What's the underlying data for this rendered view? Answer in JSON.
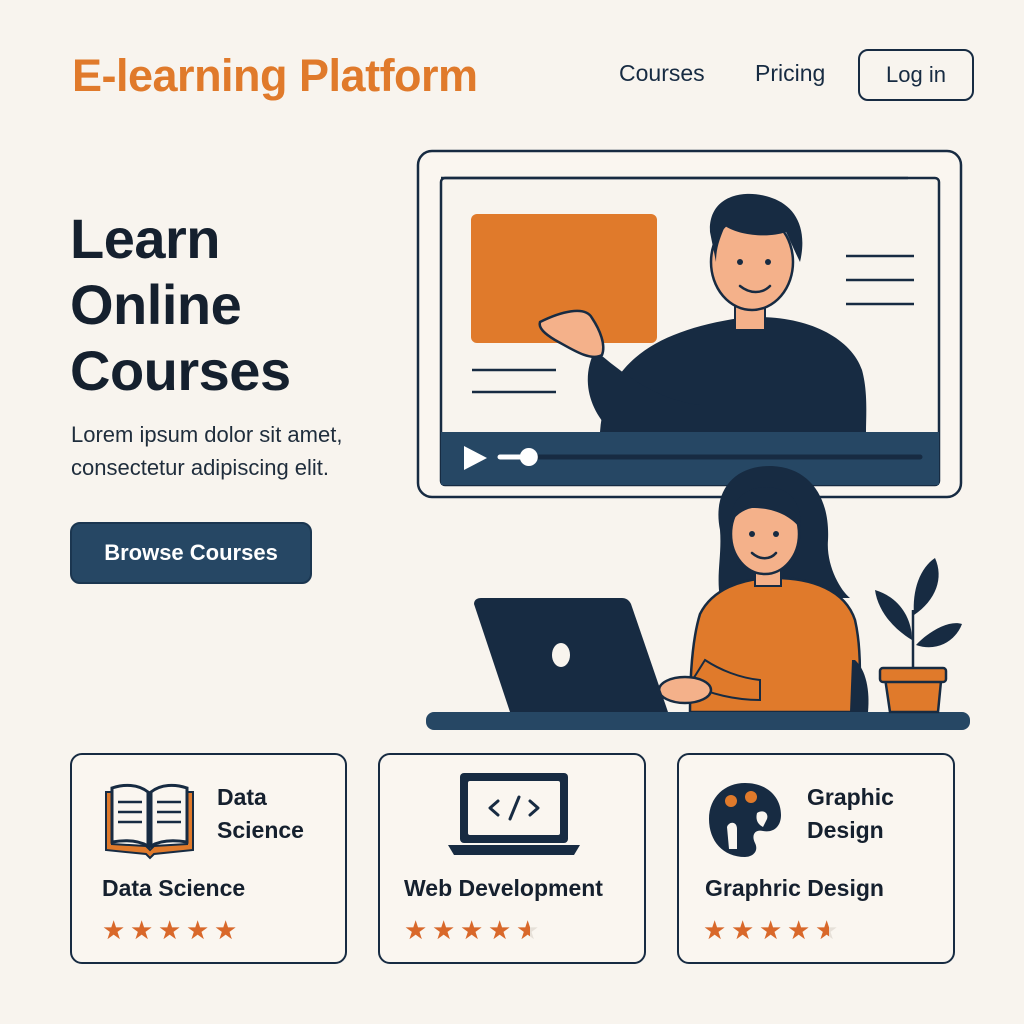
{
  "header": {
    "brand": "E-learning Platform",
    "nav": [
      {
        "label": "Courses"
      },
      {
        "label": "Pricing"
      }
    ],
    "login_label": "Log in"
  },
  "hero": {
    "title_lines": [
      "Learn",
      "Online",
      "Courses"
    ],
    "subtitle": "Lorem ipsum dolor sit amet, consectetur adipiscing elit.",
    "cta_label": "Browse Courses"
  },
  "video_player": {
    "progress": 0.04
  },
  "cards": [
    {
      "icon": "open-book-icon",
      "caption_lines": [
        "Data",
        "Science"
      ],
      "title": "Data Science",
      "rating": 5
    },
    {
      "icon": "laptop-code-icon",
      "caption_lines": [],
      "title": "Web Development",
      "rating": 4.5
    },
    {
      "icon": "palette-icon",
      "caption_lines": [
        "Graphic",
        "Design"
      ],
      "title": "Graphric Design",
      "rating": 4.5
    }
  ],
  "colors": {
    "accent": "#e07a2b",
    "navy": "#172b42",
    "button": "#264764",
    "background": "#f8f4ee",
    "star": "#d9682a"
  }
}
